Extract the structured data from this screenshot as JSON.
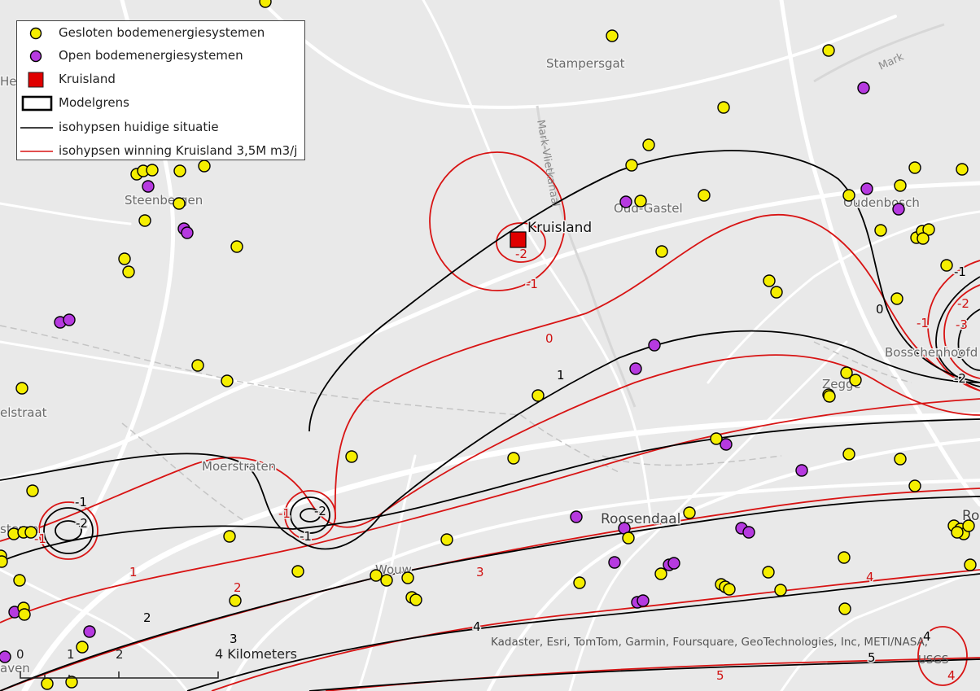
{
  "legend": {
    "items": [
      {
        "label": "Gesloten bodemenergiesystemen"
      },
      {
        "label": "Open bodemenergiesystemen"
      },
      {
        "label": "Kruisland"
      },
      {
        "label": "Modelgrens"
      },
      {
        "label": "isohypsen huidige situatie"
      },
      {
        "label": "isohypsen winning Kruisland 3,5M m3/j"
      }
    ]
  },
  "colors": {
    "gesloten": "#f5ee00",
    "open": "#b63ae0",
    "kruisland": "#e00000",
    "current": "#000000",
    "scenario": "#d81414"
  },
  "places": {
    "stampersgat": "Stampersgat",
    "steenbergen": "Steenbergen",
    "oud_gastel": "Oud-Gastel",
    "oudenbosch": "Oudenbosch",
    "kruisland": "Kruisland",
    "bosschenhoofd": "Bosschenhoofd",
    "zegge": "Zegge",
    "moerstraten": "Moerstraten",
    "roosendaal": "Roosendaal",
    "wouw": "Wouw",
    "elstraat": "elstraat",
    "steren": "steren",
    "hee": "Hee",
    "aven": "aven",
    "ro": "Ro"
  },
  "roads": {
    "mark_vlietkanaal": "Mark-Vlietkanaal",
    "mark": "Mark"
  },
  "contour_labels": {
    "c0": "0",
    "c1": "1",
    "c2": "2",
    "c3": "3",
    "c4": "4",
    "c5": "5",
    "cm1": "-1",
    "cm2": "-2",
    "cm3": "-3"
  },
  "scalebar": {
    "t0": "0",
    "t1": "1",
    "t2": "2",
    "t4": "4 Kilometers"
  },
  "attribution": {
    "line1": "Kadaster, Esri, TomTom, Garmin, Foursquare, GeoTechnologies, Inc, METI/NASA,",
    "line2": "USGS"
  }
}
